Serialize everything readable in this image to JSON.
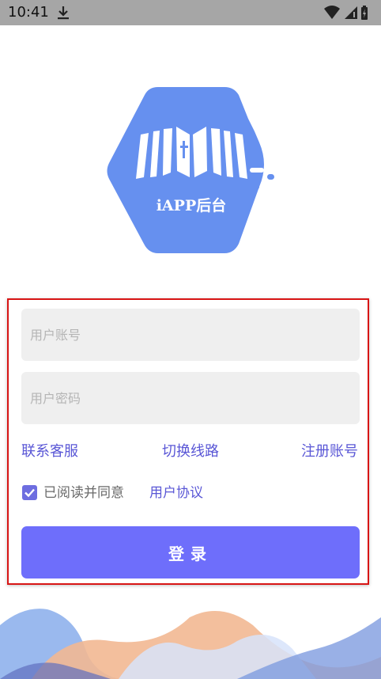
{
  "status_bar": {
    "time": "10:41",
    "icons": [
      "download-icon",
      "wifi-icon",
      "signal-icon",
      "battery-charging-icon"
    ]
  },
  "logo": {
    "text": "iAPP后台",
    "color": "#6690ef",
    "icon": "open-book-icon"
  },
  "form": {
    "account_placeholder": "用户账号",
    "password_placeholder": "用户密码",
    "links": {
      "contact": "联系客服",
      "switch_line": "切换线路",
      "register": "注册账号"
    },
    "agreement": {
      "checked": true,
      "text": "已阅读并同意",
      "link": "用户协议"
    },
    "login_label": "登录"
  },
  "colors": {
    "primary_button": "#6e6efb",
    "link": "#5a57d6",
    "field_bg": "#efefef",
    "highlight_border": "#d81515"
  }
}
